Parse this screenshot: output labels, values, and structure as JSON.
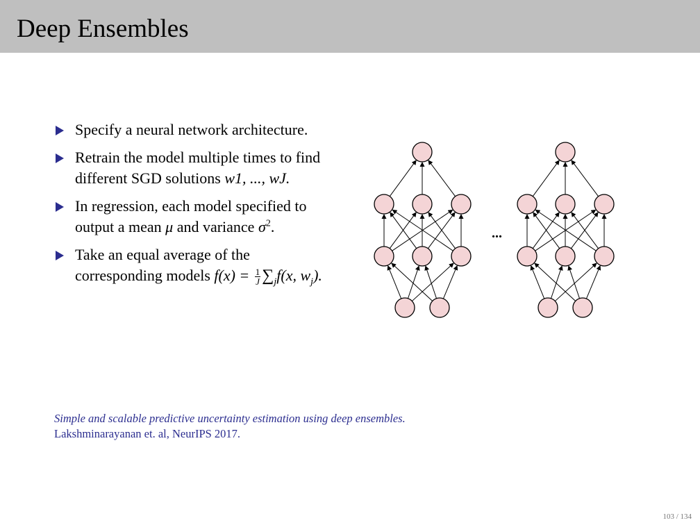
{
  "slide": {
    "title": "Deep Ensembles",
    "page_number": "103 / 134"
  },
  "bullets": [
    {
      "text": "Specify a neural network architecture."
    },
    {
      "text_before": "Retrain the model multiple times to find different SGD solutions ",
      "math": "w1, ..., wJ."
    },
    {
      "text_before": "In regression, each model specified to output a mean ",
      "mu": "μ",
      "text_middle": " and variance ",
      "sigma": "σ",
      "sigma_exp": "2",
      "text_after": "."
    },
    {
      "text_before": "Take an equal average of the corresponding models ",
      "formula_lhs": "f(x) = ",
      "frac_num": "1",
      "frac_den": "J",
      "sum_symbol": "∑",
      "sum_index": "j",
      "formula_rhs": "f(x, w",
      "formula_rhs_sub": "j",
      "formula_end": ")."
    }
  ],
  "diagram": {
    "ellipsis": "...",
    "node_color": "#f4d4d6",
    "node_stroke": "#000000",
    "networks": 2
  },
  "reference": {
    "paper": "Simple and scalable predictive uncertainty estimation using deep ensembles.",
    "authors": "Lakshminarayanan et. al, NeurIPS 2017.",
    "color": "#2b2d8f"
  }
}
